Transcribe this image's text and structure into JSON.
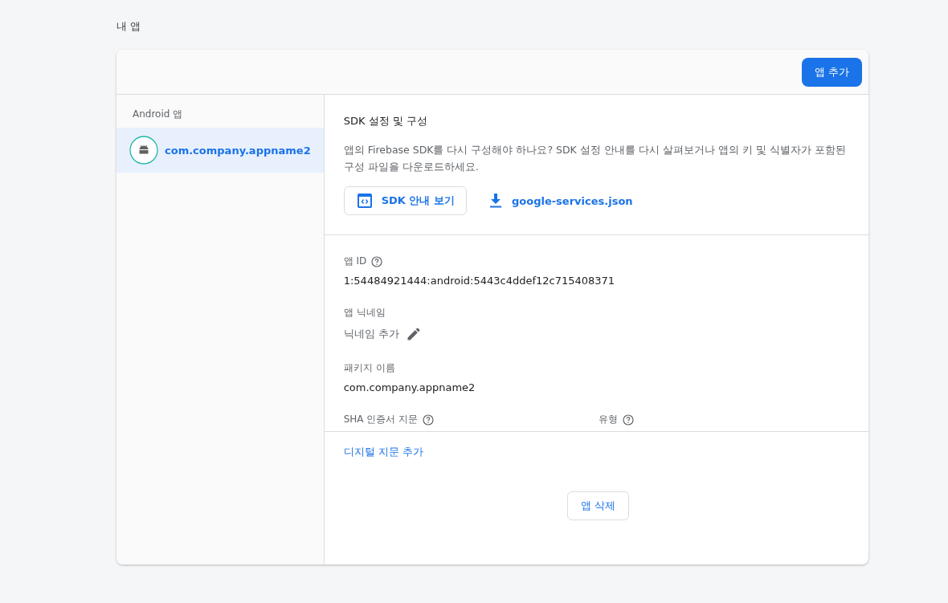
{
  "page_title": "내 앱",
  "header": {
    "add_button": "앱 추가"
  },
  "sidebar": {
    "heading": "Android 앱",
    "items": [
      {
        "label": "com.company.appname2",
        "selected": true
      }
    ]
  },
  "sdk": {
    "title": "SDK 설정 및 구성",
    "description": "앱의 Firebase SDK를 다시 구성해야 하나요? SDK 설정 안내를 다시 살펴보거나 앱의 키 및 식별자가 포함된 구성 파일을 다운로드하세요.",
    "guide_button": "SDK 안내 보기",
    "download_link": "google-services.json"
  },
  "details": {
    "app_id_label": "앱 ID",
    "app_id": "1:54484921444:android:5443c4ddef12c715408371",
    "nickname_label": "앱 닉네임",
    "nickname_add": "닉네임 추가",
    "package_label": "패키지 이름",
    "package": "com.company.appname2"
  },
  "fingerprints": {
    "columns": [
      "SHA 인증서 지문",
      "유형"
    ],
    "add_link": "디지털 지문 추가"
  },
  "delete_button": "앱 삭제"
}
